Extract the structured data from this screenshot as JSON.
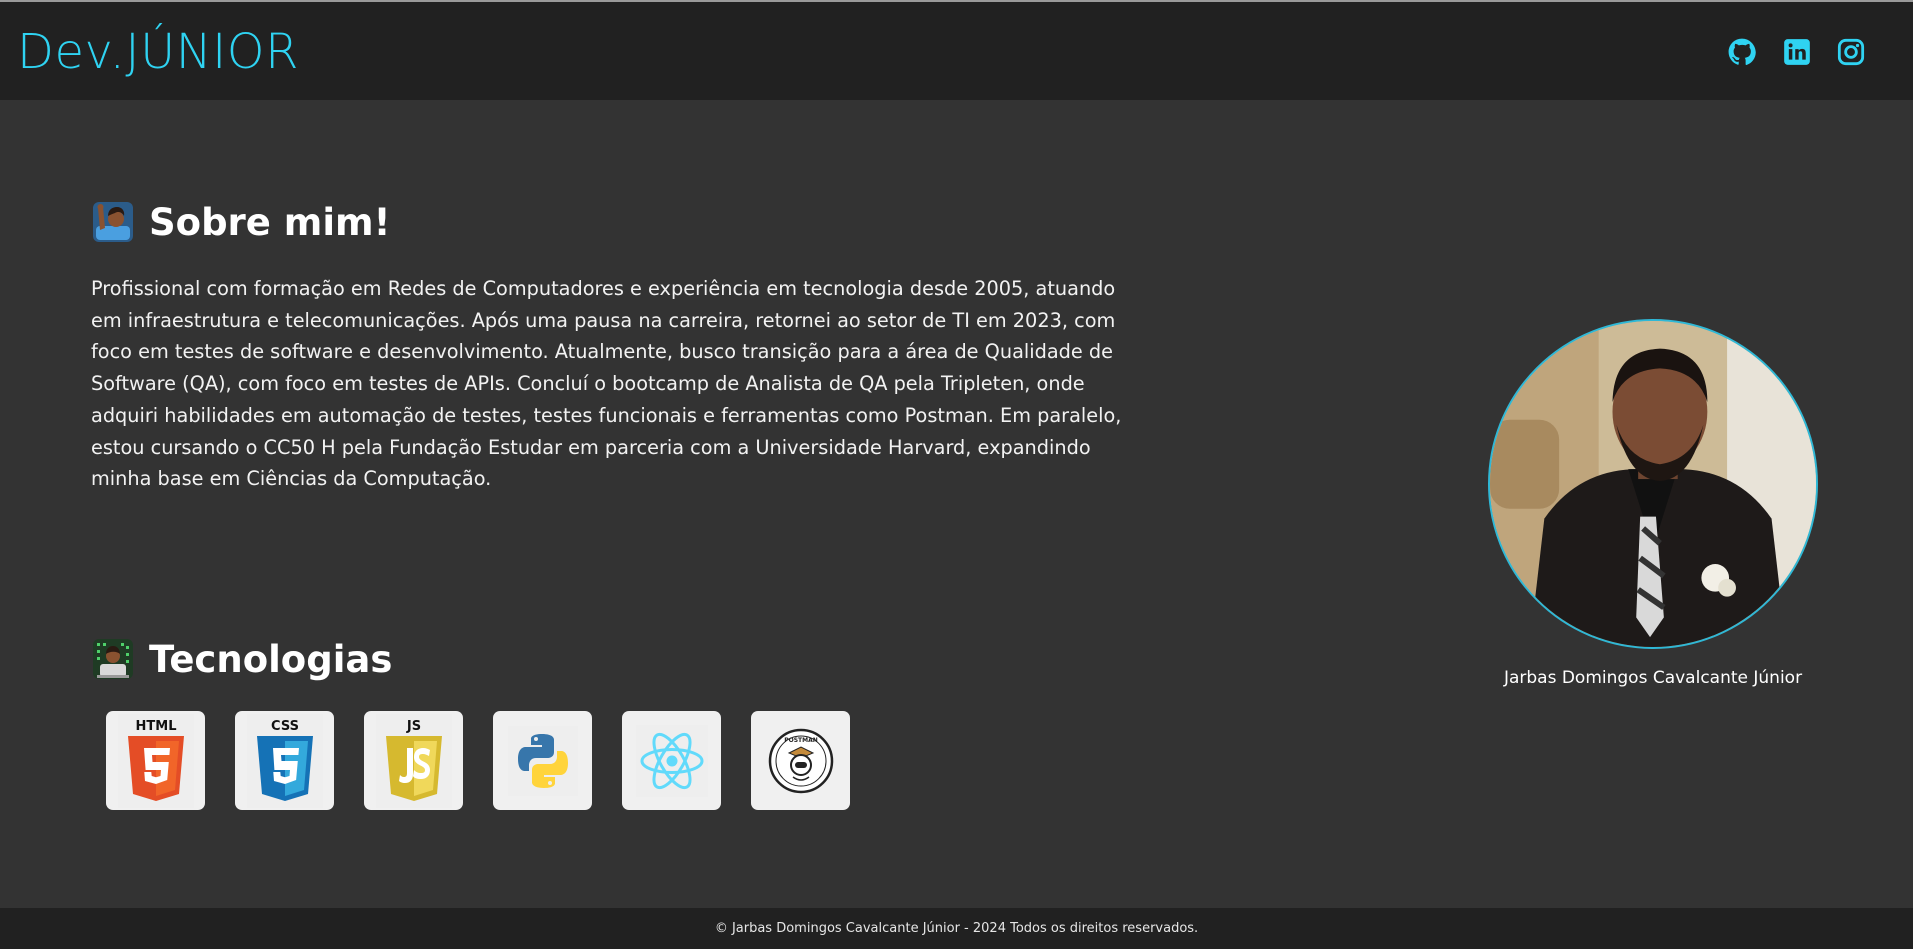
{
  "header": {
    "brand": "Dev.JÚNIOR",
    "accent_color": "#2fd3f2",
    "social_icons": [
      "github-icon",
      "linkedin-icon",
      "instagram-icon"
    ]
  },
  "about": {
    "title": "Sobre mim!",
    "emoji": "person-raising-hand",
    "text": "Profissional com formação em Redes de Computadores e experiência em tecnologia desde 2005, atuando em infraestrutura e telecomunicações. Após uma pausa na carreira, retornei ao setor de TI em 2023, com foco em testes de software e desenvolvimento. Atualmente, busco transição para a área de Qualidade de Software (QA), com foco em testes de APIs. Concluí o bootcamp de Analista de QA pela Tripleten, onde adquiri habilidades em automação de testes, testes funcionais e ferramentas como Postman. Em paralelo, estou cursando o CC50 H pela Fundação Estudar em parceria com a Universidade Harvard, expandindo minha base em Ciências da Computação."
  },
  "technologies": {
    "title": "Tecnologias",
    "emoji": "technologist",
    "items": [
      {
        "icon": "html5-icon",
        "label": "HTML"
      },
      {
        "icon": "css3-icon",
        "label": "CSS"
      },
      {
        "icon": "javascript-icon",
        "label": "JS"
      },
      {
        "icon": "python-icon"
      },
      {
        "icon": "react-icon"
      },
      {
        "icon": "postman-icon",
        "label": "POSTMAN"
      }
    ]
  },
  "profile": {
    "name": "Jarbas Domingos Cavalcante Júnior"
  },
  "footer": {
    "text": "© Jarbas Domingos Cavalcante Júnior - 2024 Todos os direitos reservados."
  }
}
